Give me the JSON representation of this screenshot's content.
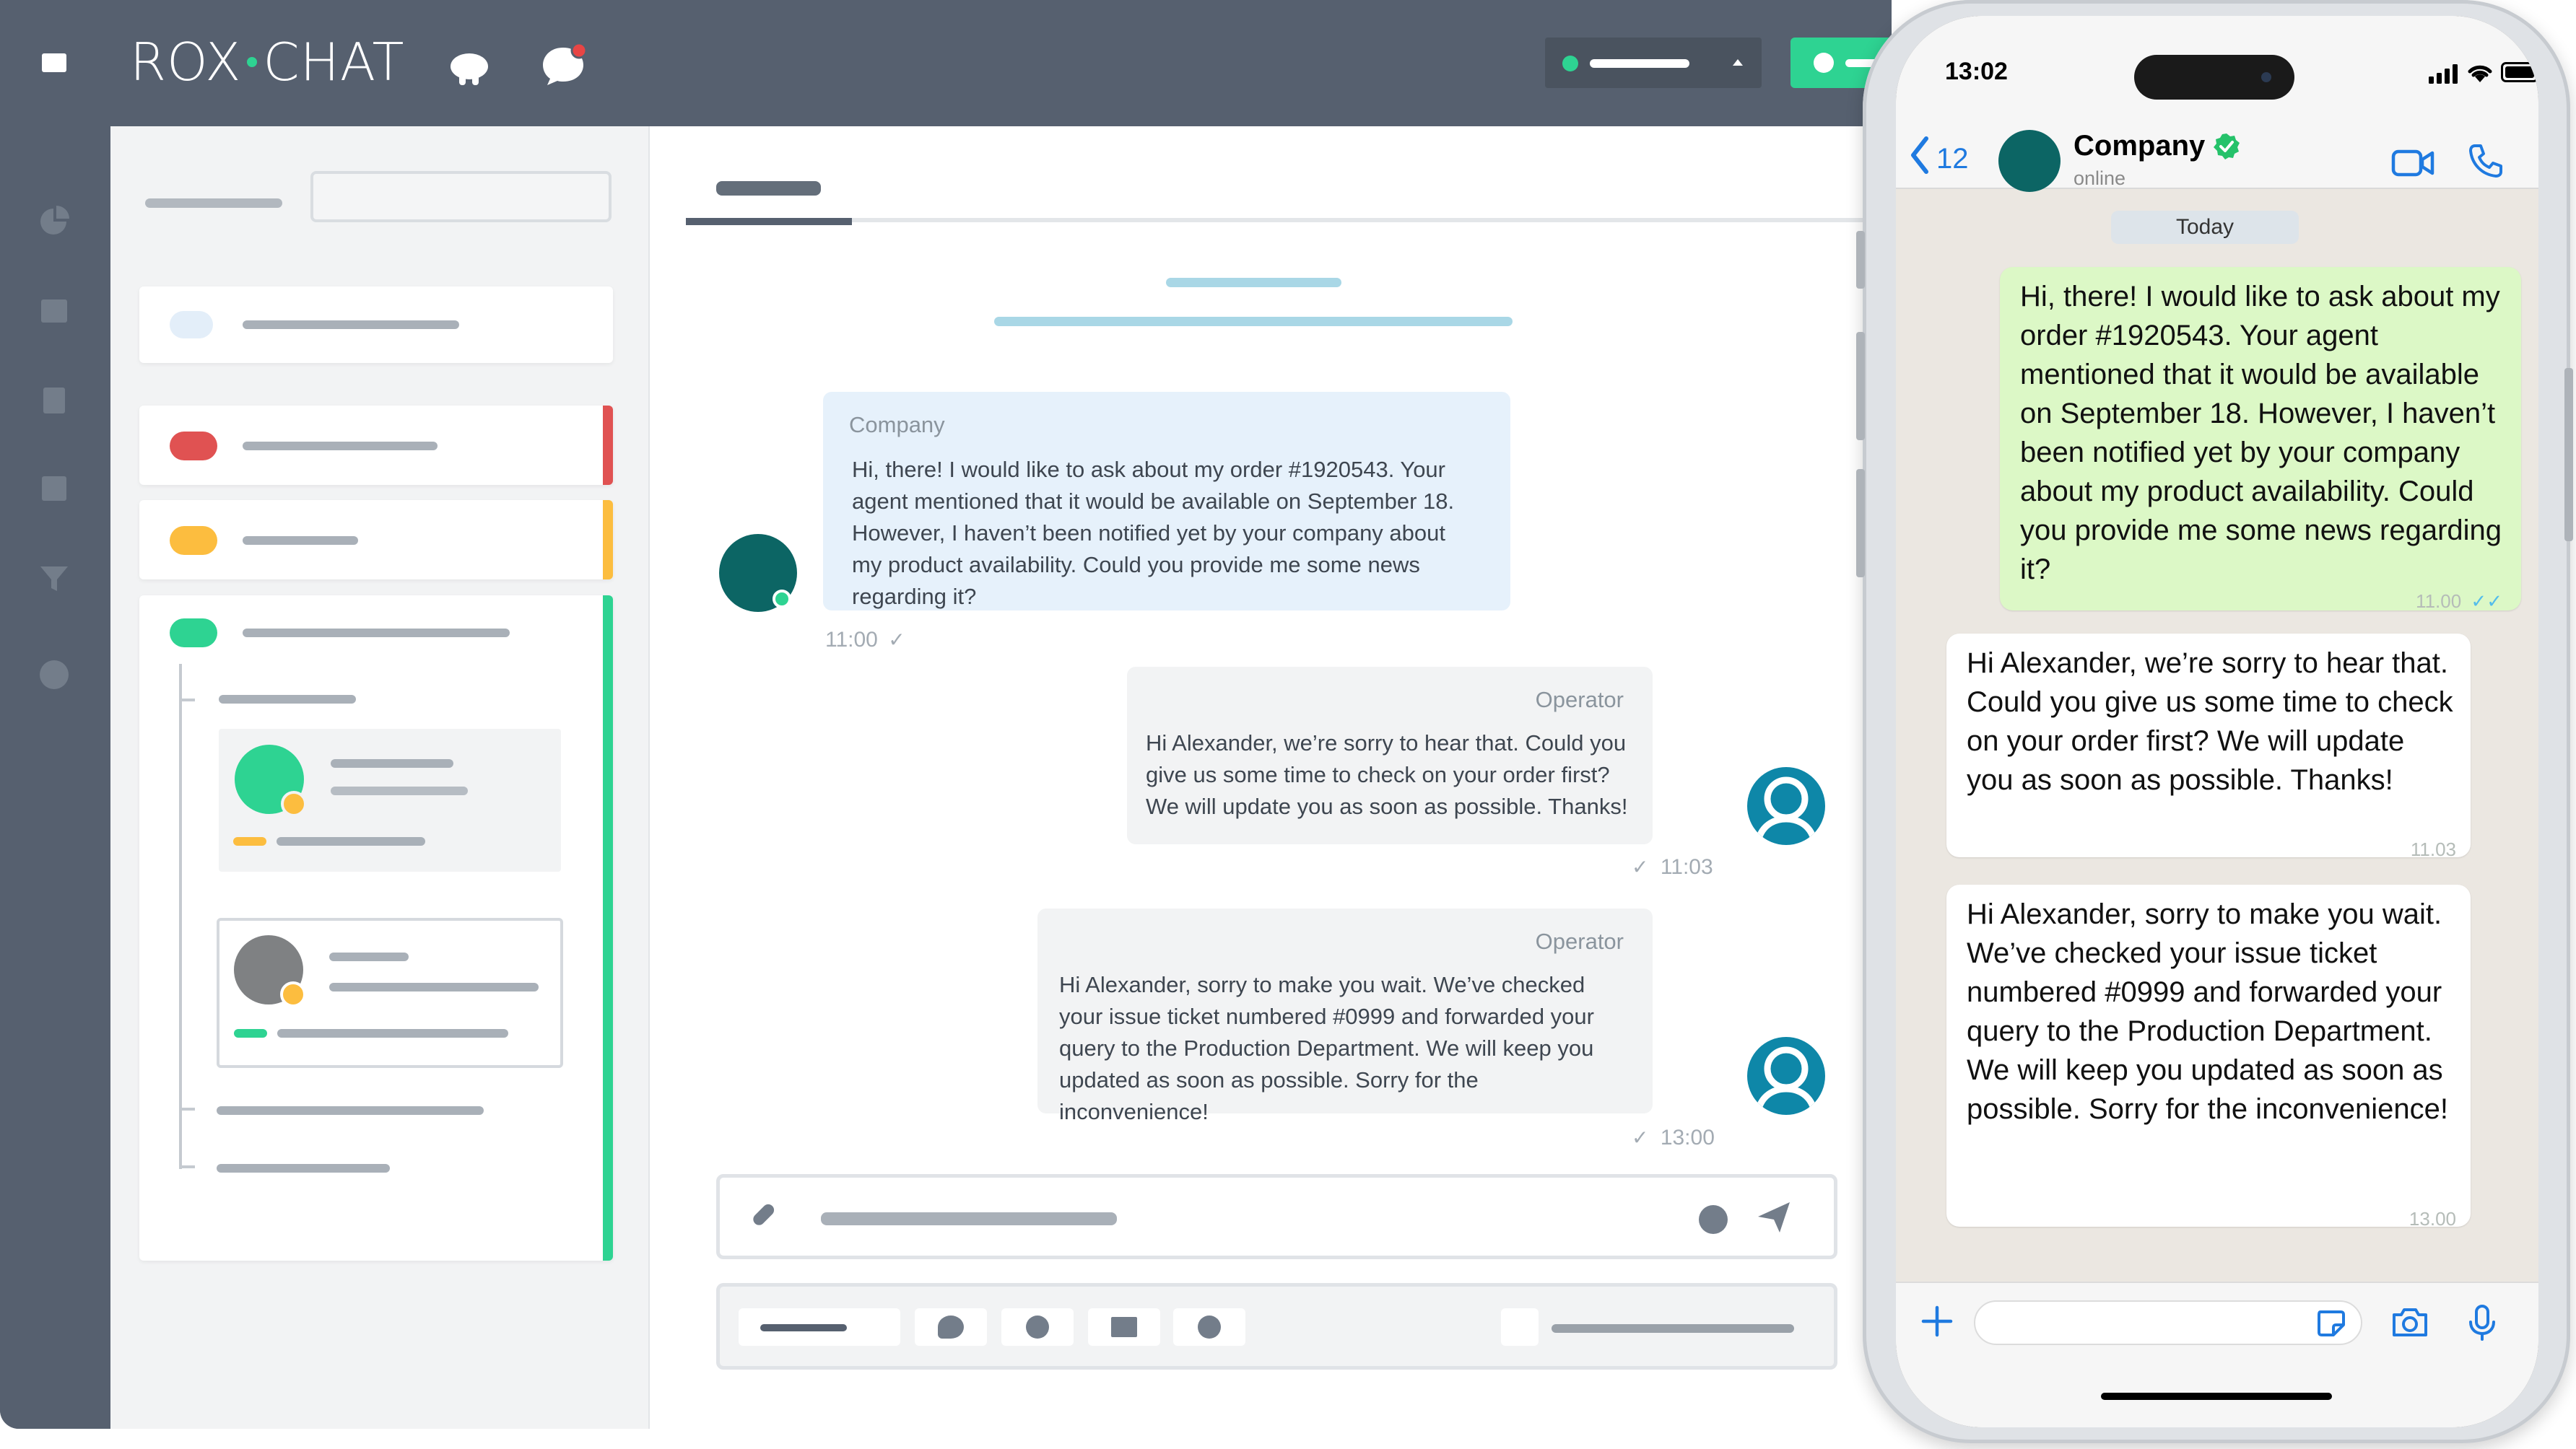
{
  "app": {
    "logo_text": "ROX",
    "logo_text2": "CHAT",
    "status_selector": "",
    "colors": {
      "green": "#2ed392",
      "red": "#e05252",
      "yellow": "#fcbd3f",
      "teal": "#0c6564",
      "blue": "#0e87a8"
    }
  },
  "chat": {
    "messages": [
      {
        "sender": "Company",
        "text": "Hi, there! I would like to ask about my order #1920543. Your agent mentioned that it would be available on September 18. However, I haven’t been notified yet by your company about my product availability. Could you provide me some news regarding it?",
        "time": "11:00"
      },
      {
        "sender": "Operator",
        "text": "Hi Alexander, we’re sorry to hear that. Could you give us some time to check on your order first? We will update you as soon as possible. Thanks!",
        "time": "11:03"
      },
      {
        "sender": "Operator",
        "text": "Hi Alexander, sorry to make you wait. We’ve checked your issue ticket numbered #0999 and forwarded your query to the Production Department. We will keep you updated as soon as possible. Sorry for the inconvenience!",
        "time": "13:00"
      }
    ]
  },
  "phone": {
    "clock": "13:02",
    "back_count": "12",
    "contact_name": "Company",
    "contact_status": "online",
    "date_chip": "Today",
    "messages": [
      {
        "text": "Hi, there! I would like to ask about my order #1920543. Your agent mentioned that it would be available on September 18. However, I haven’t been notified yet by your company about my product availability. Could you provide me some news regarding it?",
        "time": "11.00",
        "outgoing": true
      },
      {
        "text": "Hi Alexander, we’re sorry to hear that. Could you give us some time to check on your order first? We will update you as soon as possible. Thanks!",
        "time": "11.03",
        "outgoing": false
      },
      {
        "text": "Hi Alexander, sorry to make you wait. We’ve checked your issue ticket numbered #0999 and forwarded your query to the Production Department. We will keep you updated as soon as possible. Sorry for the inconvenience!",
        "time": "13.00",
        "outgoing": false
      }
    ]
  }
}
